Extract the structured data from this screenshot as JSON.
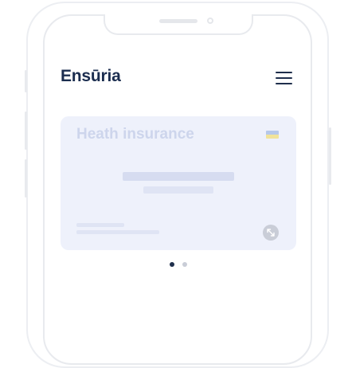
{
  "brand": {
    "name": "Ensūria"
  },
  "card": {
    "title": "Heath insurance"
  },
  "icons": {
    "menu": "hamburger-menu-icon",
    "flag": "flag-icon",
    "expand": "expand-arrows-icon"
  },
  "pagination": {
    "total": 2,
    "active": 1
  },
  "colors": {
    "primary": "#1b2d4f",
    "card_bg": "#eef1fb",
    "card_title": "#cdd5ec",
    "placeholder_bar": "#d6dcf0",
    "dot_active": "#1f2f4c",
    "dot_inactive": "#c9cdd7"
  }
}
